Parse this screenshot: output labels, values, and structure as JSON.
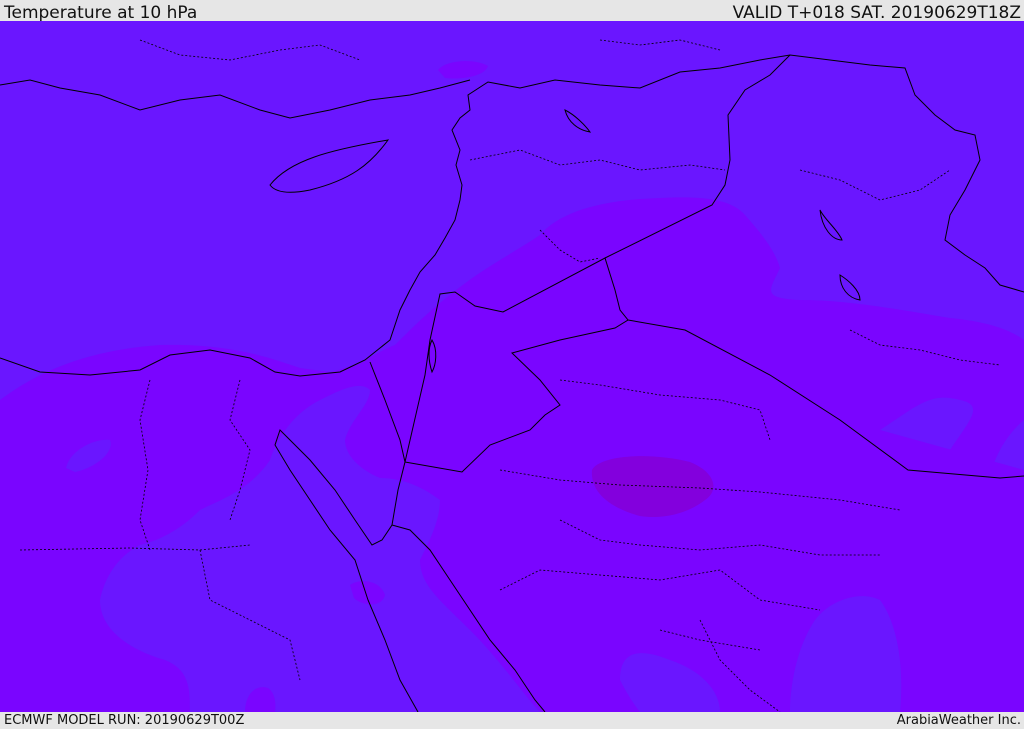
{
  "header": {
    "title": "Temperature at 10 hPa",
    "valid": "VALID T+018 SAT. 20190629T18Z"
  },
  "footer": {
    "model_run": "ECMWF MODEL RUN: 20190629T00Z",
    "credit": "ArabiaWeather Inc."
  },
  "map": {
    "colors": {
      "cold_band": "#6a16ff",
      "mid_band": "#7a05ff",
      "warm_core": "#8300dd",
      "borders": "#000000"
    },
    "region": "Eastern Mediterranean / Middle East"
  }
}
